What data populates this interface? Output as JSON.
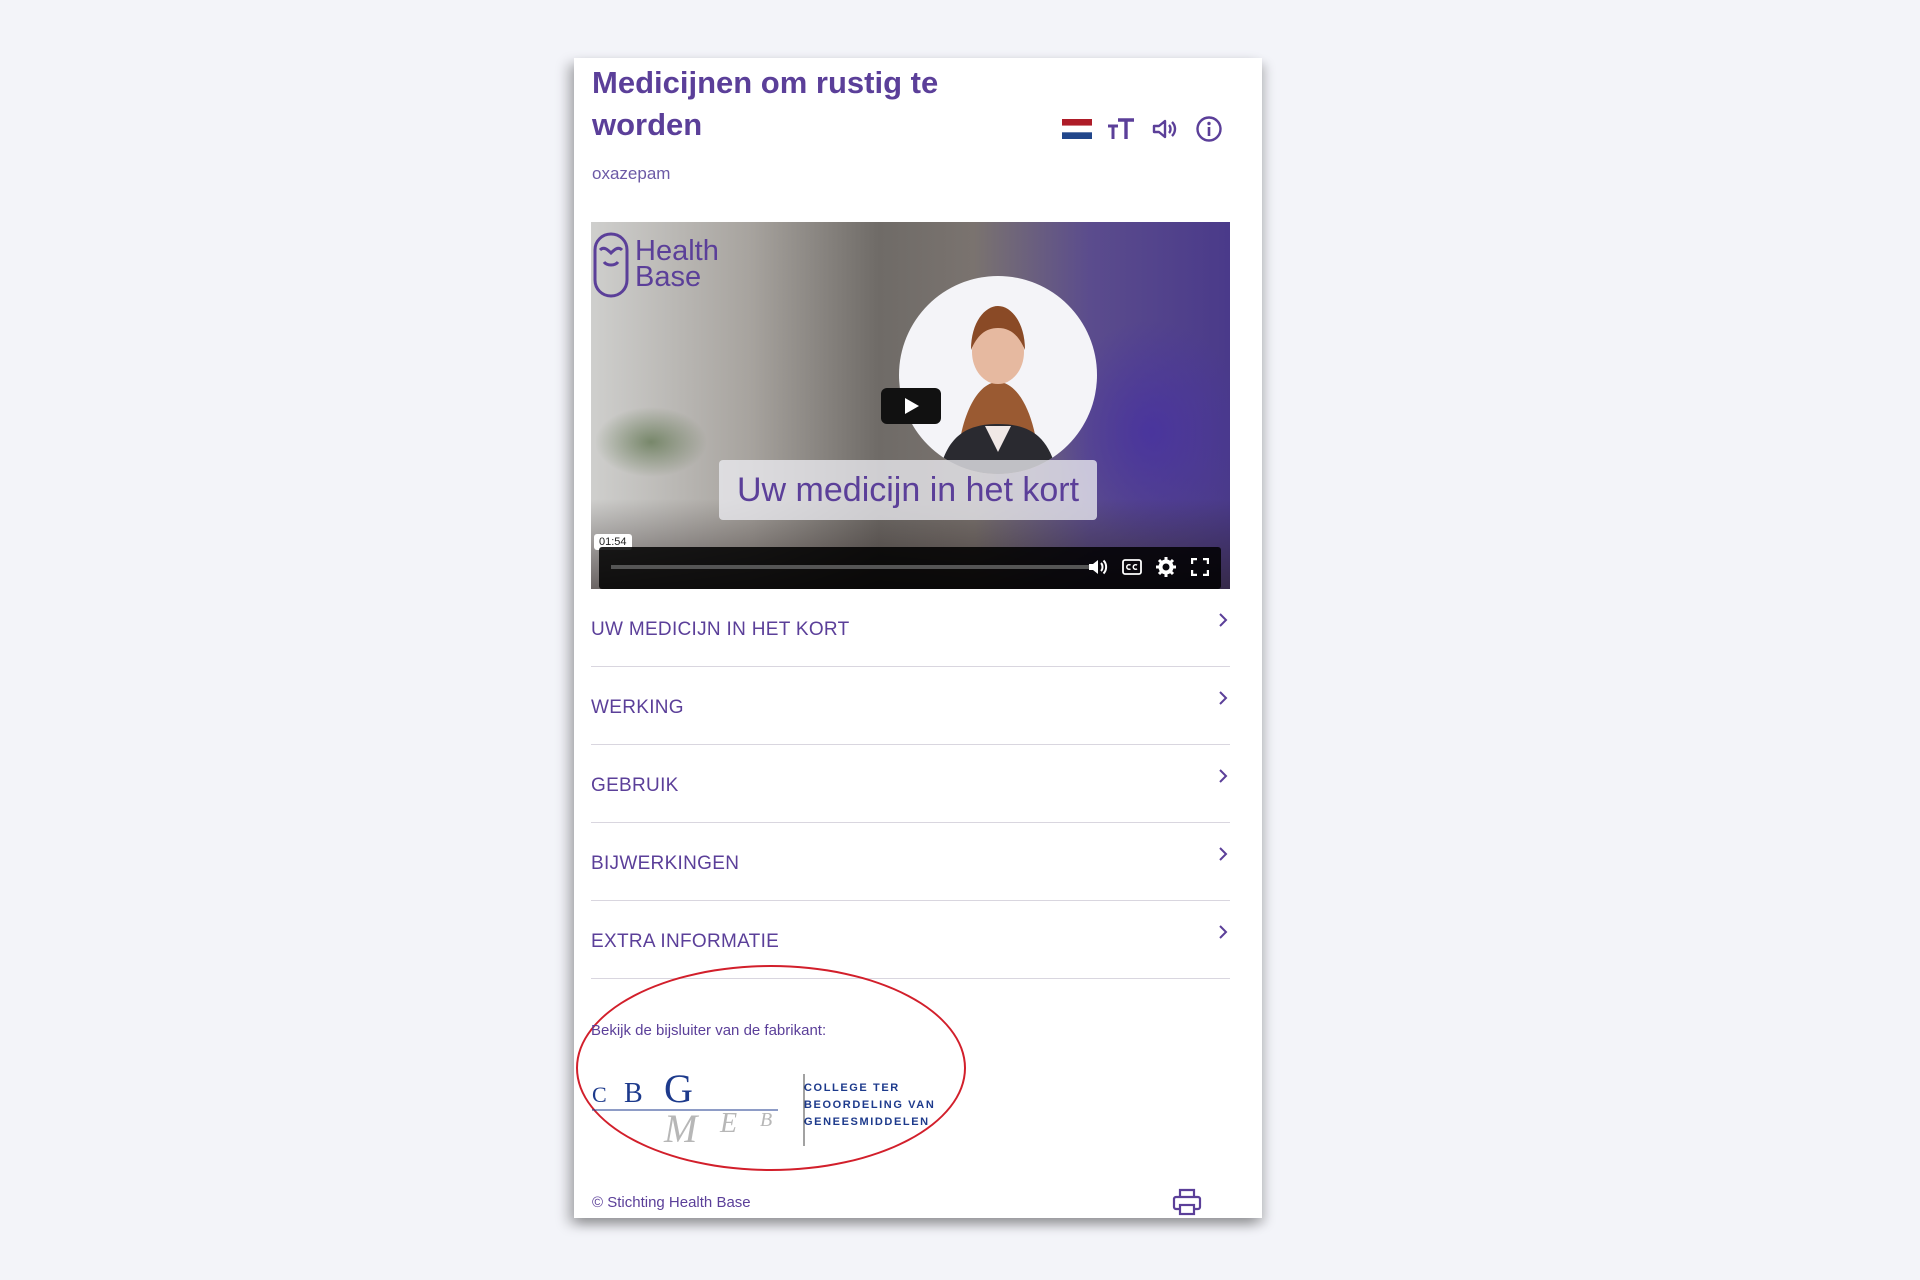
{
  "page": {
    "title": "Medicijnen om rustig te worden",
    "subtitle": "oxazepam"
  },
  "toolbar": {
    "icons": [
      "netherlands-flag-icon",
      "text-size-icon",
      "speaker-icon",
      "info-icon"
    ]
  },
  "video": {
    "logo_line1": "Health",
    "logo_line2": "Base",
    "caption": "Uw medicijn in het kort",
    "time": "01:54",
    "progress": 0.0
  },
  "accordion": {
    "items": [
      {
        "label": "UW MEDICIJN IN HET KORT"
      },
      {
        "label": "WERKING"
      },
      {
        "label": "GEBRUIK"
      },
      {
        "label": "BIJWERKINGEN"
      },
      {
        "label": "EXTRA INFORMATIE"
      }
    ]
  },
  "manufacturer": {
    "label": "Bekijk de bijsluiter van de fabrikant:",
    "logo_letters": {
      "top": [
        "C",
        "B",
        "G"
      ],
      "bottom": [
        "M",
        "E",
        "B"
      ]
    },
    "logo_text_line1": "COLLEGE TER",
    "logo_text_line2": "BEOORDELING VAN",
    "logo_text_line3": "GENEESMIDDELEN"
  },
  "footer": {
    "copyright": "© Stichting Health Base"
  },
  "colors": {
    "brand_purple": "#5b3f99",
    "annotation_red": "#d21f2b",
    "cbg_blue": "#1d3a8c"
  }
}
